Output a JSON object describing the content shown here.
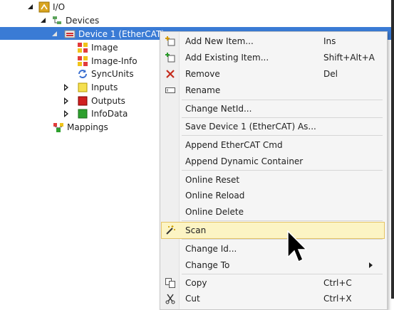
{
  "tree": {
    "io": "I/O",
    "devices": "Devices",
    "device1": "Device 1 (EtherCAT)",
    "image": "Image",
    "image_info": "Image-Info",
    "sync_units": "SyncUnits",
    "inputs": "Inputs",
    "outputs": "Outputs",
    "info_data": "InfoData",
    "mappings": "Mappings"
  },
  "menu": {
    "add_new_item": "Add New Item...",
    "add_new_item_key": "Ins",
    "add_existing_item": "Add Existing Item...",
    "add_existing_item_key": "Shift+Alt+A",
    "remove": "Remove",
    "remove_key": "Del",
    "rename": "Rename",
    "change_netid": "Change NetId...",
    "save_device": "Save Device 1 (EtherCAT) As...",
    "append_ethercat_cmd": "Append EtherCAT Cmd",
    "append_dynamic_container": "Append Dynamic Container",
    "online_reset": "Online Reset",
    "online_reload": "Online Reload",
    "online_delete": "Online Delete",
    "scan": "Scan",
    "change_id": "Change Id...",
    "change_to": "Change To",
    "copy": "Copy",
    "copy_key": "Ctrl+C",
    "cut": "Cut",
    "cut_key": "Ctrl+X"
  },
  "colors": {
    "selection": "#3a7bd5",
    "highlight": "#fcf4c4",
    "highlight_border": "#e5c365",
    "remove_icon": "#c42b1c"
  }
}
